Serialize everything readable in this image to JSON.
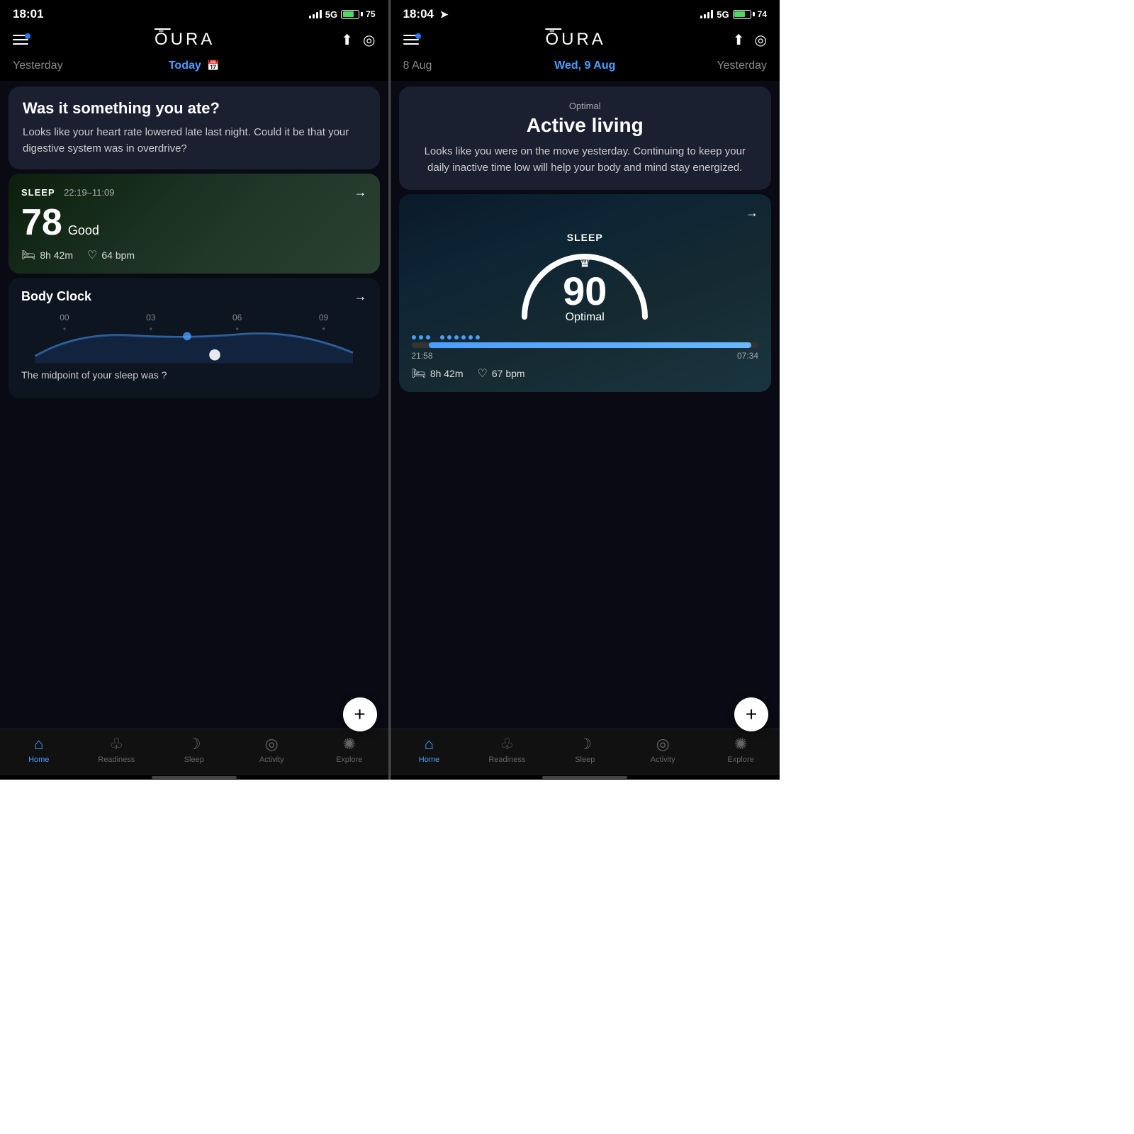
{
  "left_phone": {
    "status_bar": {
      "time": "18:01",
      "network": "5G",
      "battery_level": 75,
      "battery_pct": "75"
    },
    "top_nav": {
      "logo": "ŌURA",
      "logo_display": "OURA"
    },
    "date_tabs": {
      "yesterday": "Yesterday",
      "today": "Today",
      "today_active": true
    },
    "insight_card": {
      "title": "Was it something you ate?",
      "body": "Looks like your heart rate lowered late last night. Could it be that your digestive system was in overdrive?"
    },
    "sleep_card": {
      "label": "SLEEP",
      "time_range": "22:19–11:09",
      "score": "78",
      "quality": "Good",
      "duration": "8h 42m",
      "heart_rate": "64 bpm"
    },
    "body_clock": {
      "title": "Body Clock",
      "labels": [
        "00",
        "03",
        "06",
        "09"
      ],
      "midpoint_text": "The midpoint of your sleep was ?"
    }
  },
  "right_phone": {
    "status_bar": {
      "time": "18:04",
      "network": "5G",
      "battery_level": 74,
      "battery_pct": "74",
      "location": true
    },
    "top_nav": {
      "logo": "ŌURA",
      "logo_display": "OURA"
    },
    "date_tabs": {
      "prev": "8 Aug",
      "current": "Wed, 9 Aug",
      "next": "Yesterday"
    },
    "insight_card": {
      "badge": "Optimal",
      "title": "Active living",
      "body": "Looks like you were on the move yesterday. Continuing to keep your daily inactive time low will help your body and mind stay energized."
    },
    "sleep_gauge": {
      "label": "SLEEP",
      "score": "90",
      "quality": "Optimal",
      "time_start": "21:58",
      "time_end": "07:34",
      "duration": "8h 42m",
      "heart_rate": "67 bpm"
    }
  },
  "bottom_nav": {
    "items": [
      {
        "label": "Home",
        "icon": "home",
        "active": true
      },
      {
        "label": "Readiness",
        "icon": "readiness",
        "active": false
      },
      {
        "label": "Sleep",
        "icon": "sleep",
        "active": false
      },
      {
        "label": "Activity",
        "icon": "activity",
        "active": false
      },
      {
        "label": "Explore",
        "icon": "explore",
        "active": false
      }
    ]
  }
}
